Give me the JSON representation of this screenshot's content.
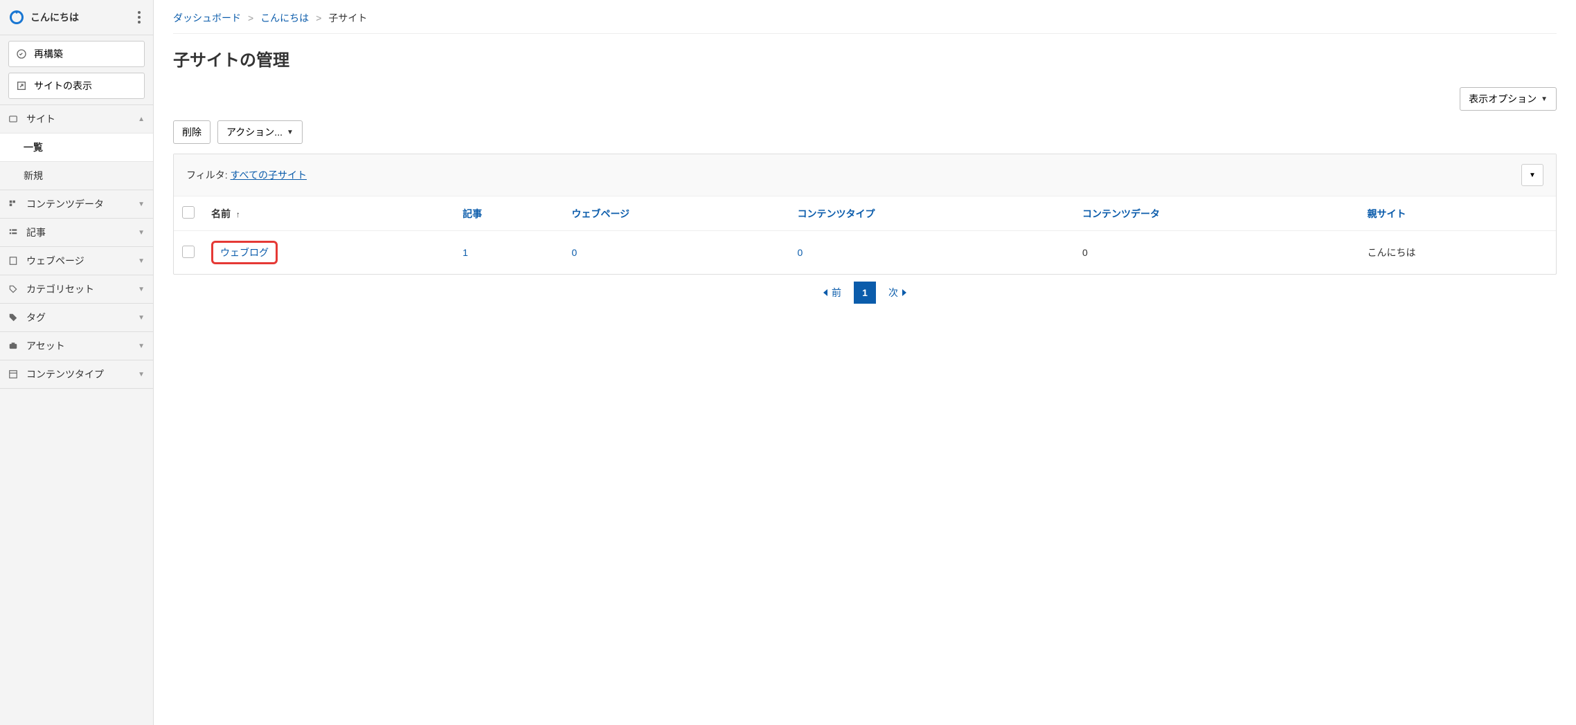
{
  "sidebar": {
    "site_name": "こんにちは",
    "actions": {
      "rebuild": "再構築",
      "view_site": "サイトの表示"
    },
    "nav": {
      "site": {
        "label": "サイト",
        "items": {
          "list": "一覧",
          "new": "新規"
        }
      },
      "content_data": {
        "label": "コンテンツデータ"
      },
      "entries": {
        "label": "記事"
      },
      "pages": {
        "label": "ウェブページ"
      },
      "category_sets": {
        "label": "カテゴリセット"
      },
      "tags": {
        "label": "タグ"
      },
      "assets": {
        "label": "アセット"
      },
      "content_types": {
        "label": "コンテンツタイプ"
      }
    }
  },
  "breadcrumb": {
    "dashboard": "ダッシュボード",
    "sep": ">",
    "site": "こんにちは",
    "current": "子サイト"
  },
  "page_title": "子サイトの管理",
  "toolbar": {
    "display_options": "表示オプション",
    "delete": "削除",
    "actions": "アクション..."
  },
  "filter": {
    "label": "フィルタ:",
    "current": "すべての子サイト"
  },
  "table": {
    "columns": {
      "name": "名前",
      "entries": "記事",
      "pages": "ウェブページ",
      "content_types": "コンテンツタイプ",
      "content_data": "コンテンツデータ",
      "parent": "親サイト"
    },
    "rows": [
      {
        "name": "ウェブログ",
        "entries": "1",
        "pages": "0",
        "content_types": "0",
        "content_data": "0",
        "parent": "こんにちは"
      }
    ]
  },
  "pagination": {
    "prev": "前",
    "current": "1",
    "next": "次"
  }
}
